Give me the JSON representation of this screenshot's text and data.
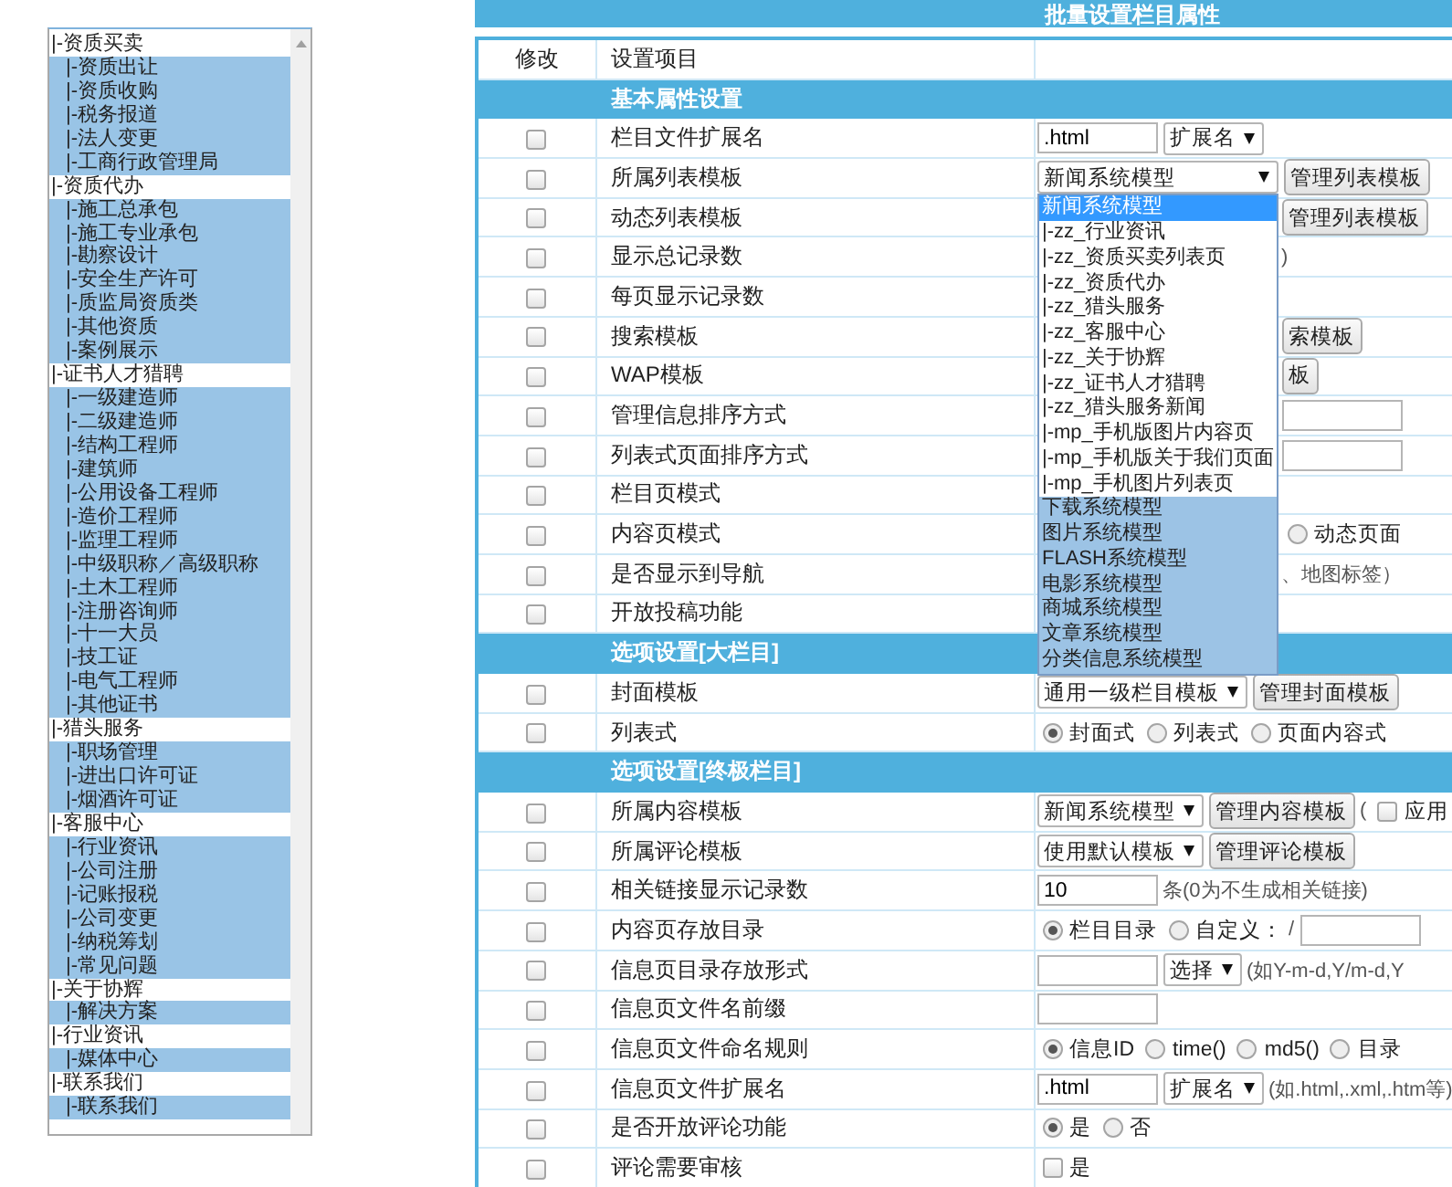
{
  "sidebar": {
    "items": [
      {
        "label": "|-资质买卖",
        "selected": false,
        "children": [
          {
            "label": "|-资质出让",
            "selected": true
          },
          {
            "label": "|-资质收购",
            "selected": true
          },
          {
            "label": "|-税务报道",
            "selected": true
          },
          {
            "label": "|-法人变更",
            "selected": true
          },
          {
            "label": "|-工商行政管理局",
            "selected": true
          }
        ]
      },
      {
        "label": "|-资质代办",
        "selected": false,
        "children": [
          {
            "label": "|-施工总承包",
            "selected": true
          },
          {
            "label": "|-施工专业承包",
            "selected": true
          },
          {
            "label": "|-勘察设计",
            "selected": true
          },
          {
            "label": "|-安全生产许可",
            "selected": true
          },
          {
            "label": "|-质监局资质类",
            "selected": true
          },
          {
            "label": "|-其他资质",
            "selected": true
          },
          {
            "label": "|-案例展示",
            "selected": true
          }
        ]
      },
      {
        "label": "|-证书人才猎聘",
        "selected": false,
        "children": [
          {
            "label": "|-一级建造师",
            "selected": true
          },
          {
            "label": "|-二级建造师",
            "selected": true
          },
          {
            "label": "|-结构工程师",
            "selected": true
          },
          {
            "label": "|-建筑师",
            "selected": true
          },
          {
            "label": "|-公用设备工程师",
            "selected": true
          },
          {
            "label": "|-造价工程师",
            "selected": true
          },
          {
            "label": "|-监理工程师",
            "selected": true
          },
          {
            "label": "|-中级职称／高级职称",
            "selected": true
          },
          {
            "label": "|-土木工程师",
            "selected": true
          },
          {
            "label": "|-注册咨询师",
            "selected": true
          },
          {
            "label": "|-十一大员",
            "selected": true
          },
          {
            "label": "|-技工证",
            "selected": true
          },
          {
            "label": "|-电气工程师",
            "selected": true
          },
          {
            "label": "|-其他证书",
            "selected": true
          }
        ]
      },
      {
        "label": "|-猎头服务",
        "selected": false,
        "children": [
          {
            "label": "|-职场管理",
            "selected": true
          },
          {
            "label": "|-进出口许可证",
            "selected": true
          },
          {
            "label": "|-烟酒许可证",
            "selected": true
          }
        ]
      },
      {
        "label": "|-客服中心",
        "selected": false,
        "children": [
          {
            "label": "|-行业资讯",
            "selected": true
          },
          {
            "label": "|-公司注册",
            "selected": true
          },
          {
            "label": "|-记账报税",
            "selected": true
          },
          {
            "label": "|-公司变更",
            "selected": true
          },
          {
            "label": "|-纳税筹划",
            "selected": true
          },
          {
            "label": "|-常见问题",
            "selected": true
          }
        ]
      },
      {
        "label": "|-关于协辉",
        "selected": false,
        "children": [
          {
            "label": "|-解决方案",
            "selected": true
          }
        ]
      },
      {
        "label": "|-行业资讯",
        "selected": false,
        "children": [
          {
            "label": "|-媒体中心",
            "selected": true
          }
        ]
      },
      {
        "label": "|-联系我们",
        "selected": false,
        "children": [
          {
            "label": "|-联系我们",
            "selected": true
          }
        ]
      }
    ]
  },
  "panel": {
    "title": "批量设置栏目属性",
    "columns": [
      "修改",
      "设置项目"
    ],
    "rows": [
      {
        "kind": "section",
        "label": "基本属性设置"
      },
      {
        "kind": "setting",
        "label": "栏目文件扩展名",
        "checked": false,
        "controls": [
          {
            "kind": "input",
            "value": ".html"
          },
          {
            "kind": "select",
            "value": "扩展名"
          }
        ]
      },
      {
        "kind": "setting",
        "label": "所属列表模板",
        "checked": false,
        "controls": [
          {
            "kind": "select",
            "value": "新闻系统模型",
            "expanded": true,
            "options": [
              {
                "label": "新闻系统模型",
                "kind": "model",
                "selected": true
              },
              {
                "label": "|-zz_行业资讯",
                "kind": "template",
                "selected": false
              },
              {
                "label": "|-zz_资质买卖列表页",
                "kind": "template",
                "selected": false
              },
              {
                "label": "|-zz_资质代办",
                "kind": "template",
                "selected": false
              },
              {
                "label": "|-zz_猎头服务",
                "kind": "template",
                "selected": false
              },
              {
                "label": "|-zz_客服中心",
                "kind": "template",
                "selected": false
              },
              {
                "label": "|-zz_关于协辉",
                "kind": "template",
                "selected": false
              },
              {
                "label": "|-zz_证书人才猎聘",
                "kind": "template",
                "selected": false
              },
              {
                "label": "|-zz_猎头服务新闻",
                "kind": "template",
                "selected": false
              },
              {
                "label": "|-mp_手机版图片内容页",
                "kind": "template",
                "selected": false
              },
              {
                "label": "|-mp_手机版关于我们页面",
                "kind": "template",
                "selected": false
              },
              {
                "label": "|-mp_手机图片列表页",
                "kind": "template",
                "selected": false
              },
              {
                "label": "下载系统模型",
                "kind": "model",
                "selected": false
              },
              {
                "label": "图片系统模型",
                "kind": "model",
                "selected": false
              },
              {
                "label": "FLASH系统模型",
                "kind": "model",
                "selected": false
              },
              {
                "label": "电影系统模型",
                "kind": "model",
                "selected": false
              },
              {
                "label": "商城系统模型",
                "kind": "model",
                "selected": false
              },
              {
                "label": "文章系统模型",
                "kind": "model",
                "selected": false
              },
              {
                "label": "分类信息系统模型",
                "kind": "model",
                "selected": false
              }
            ]
          },
          {
            "kind": "button",
            "label": "管理列表模板"
          }
        ]
      },
      {
        "kind": "setting",
        "label": "动态列表模板",
        "checked": false,
        "covered": true,
        "controls": [
          {
            "kind": "button",
            "label": "管理列表模板"
          }
        ]
      },
      {
        "kind": "setting",
        "label": "显示总记录数",
        "checked": false,
        "covered": true,
        "controls": [
          {
            "kind": "text",
            "text": ")"
          }
        ]
      },
      {
        "kind": "setting",
        "label": "每页显示记录数",
        "checked": false
      },
      {
        "kind": "setting",
        "label": "搜索模板",
        "checked": false,
        "covered": true,
        "controls": [
          {
            "kind": "button",
            "label": "索模板"
          }
        ]
      },
      {
        "kind": "setting",
        "label": "WAP模板",
        "checked": false,
        "covered": true,
        "controls": [
          {
            "kind": "button",
            "label": "板"
          }
        ]
      },
      {
        "kind": "setting",
        "label": "管理信息排序方式",
        "checked": false,
        "covered": true,
        "controls": [
          {
            "kind": "input"
          }
        ]
      },
      {
        "kind": "setting",
        "label": "列表式页面排序方式",
        "checked": false,
        "covered": true,
        "controls": [
          {
            "kind": "input"
          }
        ]
      },
      {
        "kind": "setting",
        "label": "栏目页模式",
        "checked": false
      },
      {
        "kind": "setting",
        "label": "内容页模式",
        "checked": false,
        "covered": true,
        "controls": [
          {
            "kind": "radio",
            "label": "动态页面",
            "selected": false
          }
        ]
      },
      {
        "kind": "setting",
        "label": "是否显示到导航",
        "checked": false,
        "covered": true,
        "controls": [
          {
            "kind": "text",
            "text": "、地图标签）"
          }
        ]
      },
      {
        "kind": "setting",
        "label": "开放投稿功能",
        "checked": false
      },
      {
        "kind": "section",
        "label": "选项设置[大栏目]"
      },
      {
        "kind": "setting",
        "label": "封面模板",
        "checked": false,
        "controls": [
          {
            "kind": "select",
            "value": "通用一级栏目模板"
          },
          {
            "kind": "button",
            "label": "管理封面模板"
          }
        ]
      },
      {
        "kind": "setting",
        "label": "列表式",
        "checked": false,
        "controls": [
          {
            "kind": "radio",
            "label": "封面式",
            "selected": true
          },
          {
            "kind": "radio",
            "label": "列表式",
            "selected": false
          },
          {
            "kind": "radio",
            "label": "页面内容式",
            "selected": false
          }
        ]
      },
      {
        "kind": "section",
        "label": "选项设置[终极栏目]"
      },
      {
        "kind": "setting",
        "label": "所属内容模板",
        "checked": false,
        "controls": [
          {
            "kind": "select",
            "value": "新闻系统模型"
          },
          {
            "kind": "button",
            "label": "管理内容模板"
          },
          {
            "kind": "text",
            "text": "("
          },
          {
            "kind": "checkbox",
            "label": "应用",
            "checked": false
          }
        ]
      },
      {
        "kind": "setting",
        "label": "所属评论模板",
        "checked": false,
        "controls": [
          {
            "kind": "select",
            "value": "使用默认模板"
          },
          {
            "kind": "button",
            "label": "管理评论模板"
          }
        ]
      },
      {
        "kind": "setting",
        "label": "相关链接显示记录数",
        "checked": false,
        "controls": [
          {
            "kind": "input",
            "value": "10"
          },
          {
            "kind": "text",
            "text": "条(0为不生成相关链接)"
          }
        ]
      },
      {
        "kind": "setting",
        "label": "内容页存放目录",
        "checked": false,
        "controls": [
          {
            "kind": "radio",
            "label": "栏目目录",
            "selected": true
          },
          {
            "kind": "radio",
            "label": "自定义：",
            "selected": false
          },
          {
            "kind": "text",
            "text": "/"
          },
          {
            "kind": "input"
          }
        ]
      },
      {
        "kind": "setting",
        "label": "信息页目录存放形式",
        "checked": false,
        "controls": [
          {
            "kind": "input"
          },
          {
            "kind": "select",
            "value": "选择"
          },
          {
            "kind": "text",
            "text": "(如Y-m-d,Y/m-d,Y"
          }
        ]
      },
      {
        "kind": "setting",
        "label": "信息页文件名前缀",
        "checked": false,
        "controls": [
          {
            "kind": "input"
          }
        ]
      },
      {
        "kind": "setting",
        "label": "信息页文件命名规则",
        "checked": false,
        "controls": [
          {
            "kind": "radio",
            "label": "信息ID",
            "selected": true
          },
          {
            "kind": "radio",
            "label": "time()",
            "selected": false
          },
          {
            "kind": "radio",
            "label": "md5()",
            "selected": false
          },
          {
            "kind": "radio",
            "label": "目录",
            "selected": false
          }
        ]
      },
      {
        "kind": "setting",
        "label": "信息页文件扩展名",
        "checked": false,
        "controls": [
          {
            "kind": "input",
            "value": ".html"
          },
          {
            "kind": "select",
            "value": "扩展名"
          },
          {
            "kind": "text",
            "text": "(如.html,.xml,.htm等)"
          }
        ]
      },
      {
        "kind": "setting",
        "label": "是否开放评论功能",
        "checked": false,
        "controls": [
          {
            "kind": "radio",
            "label": "是",
            "selected": true
          },
          {
            "kind": "radio",
            "label": "否",
            "selected": false
          }
        ]
      },
      {
        "kind": "setting",
        "label": "评论需要审核",
        "checked": false,
        "controls": [
          {
            "kind": "checkbox",
            "label": "是",
            "checked": false
          }
        ]
      }
    ]
  }
}
